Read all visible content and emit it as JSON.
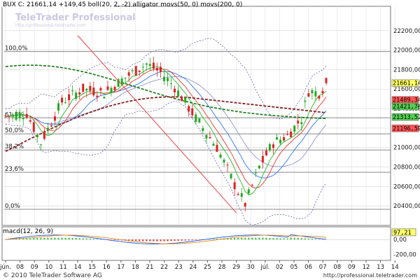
{
  "header": {
    "main": "BUX C: 21661,14 +149,45 boll(20, 2, -2) alligator movs(50, 0) movs(200, 0)",
    "macd": "macd(12, 26, 9)"
  },
  "watermark": {
    "brand": "TeleTrader Professional",
    "url": "http://professional.teletrader.com"
  },
  "footer": {
    "copyright": "© 2010 TeleTrader Software AG",
    "url": "http://professional.teletrader.com"
  },
  "colors": {
    "up": "#22aa22",
    "down": "#dd2222",
    "ma50": "#117711",
    "ma200": "#882222",
    "trend": "#ee4444",
    "boll": "#6666bb",
    "fib": "#888888",
    "lastprice_bg": "#ffff66"
  },
  "chart_data": [
    {
      "type": "candlestick",
      "title": "BUX C: 21661,14 +149,45 boll(20, 2, -2) alligator movs(50, 0) movs(200, 0)",
      "ylim": [
        20200,
        22450
      ],
      "y_ticks": [
        20400,
        20600,
        20800,
        21000,
        21200,
        21400,
        21600,
        21800,
        22000,
        22200
      ],
      "y_tick_labels": [
        "20400,00",
        "20600,00",
        "20800,00",
        "21000,00",
        "21200,00",
        "21400,00",
        "21600,00",
        "21800,00",
        "22000,00",
        "22200,00"
      ],
      "x_tick_labels": [
        "jún.",
        "08",
        "09",
        "10",
        "11",
        "14",
        "15",
        "16",
        "17",
        "18",
        "21",
        "22",
        "23",
        "24",
        "25",
        "28",
        "29",
        "30",
        "júl.",
        "02",
        "05",
        "06",
        "07",
        "08",
        "09",
        "12",
        "13",
        "14"
      ],
      "grid": true,
      "fib_levels": [
        {
          "label": "100,0%",
          "value": 21985
        },
        {
          "label": "61,8%",
          "value": 21305
        },
        {
          "label": "50,0%",
          "value": 21140
        },
        {
          "label": "38,2%",
          "value": 20975
        },
        {
          "label": "23,6%",
          "value": 20745
        },
        {
          "label": "0,0%",
          "value": 20365
        }
      ],
      "price_labels": [
        {
          "text": "21661,14",
          "value": 21661.14,
          "highlight": true
        },
        {
          "text": "21489,34",
          "value": 21489.34
        },
        {
          "text": "21421,76",
          "value": 21421.76
        },
        {
          "text": "21313,52",
          "value": 21313.52
        },
        {
          "text": "21196,59",
          "value": 21196.59
        }
      ],
      "trendline": [
        {
          "x": "29",
          "y": 20330
        },
        {
          "x": "14",
          "y": 22150
        }
      ],
      "last_close": 21661.14
    },
    {
      "type": "line",
      "title": "macd(12, 26, 9)",
      "ylim": [
        -280,
        170
      ],
      "y_ticks": [
        0,
        -200
      ],
      "y_tick_labels": [
        "0,00",
        "-200,00"
      ],
      "last_value_label": "97,21"
    }
  ]
}
